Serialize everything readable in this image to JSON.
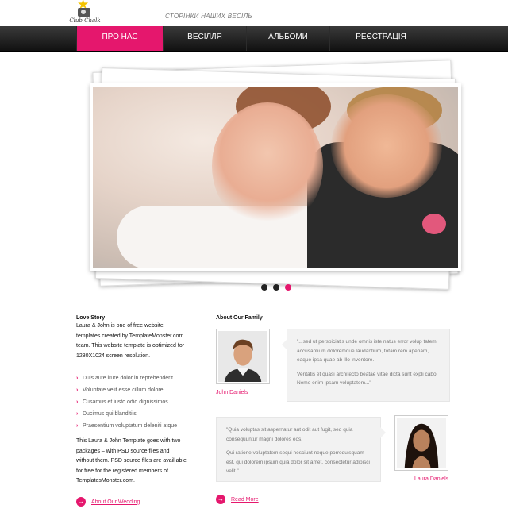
{
  "header": {
    "logo_text": "Club Chalk",
    "tagline": "СТОРІНКИ НАШИХ ВЕСІЛЬ"
  },
  "nav": {
    "items": [
      {
        "label": "ПРО НАС",
        "active": true
      },
      {
        "label": "ВЕСІЛЛЯ",
        "active": false
      },
      {
        "label": "АЛЬБОМИ",
        "active": false
      },
      {
        "label": "РЕЄСТРАЦІЯ",
        "active": false
      }
    ]
  },
  "slider": {
    "image": "wedding-couple-photo",
    "pagination": {
      "count": 3,
      "active_index": 2
    }
  },
  "love_story": {
    "title": "Love Story",
    "intro": "Laura & John is one of free website templates created by TemplateMonster.com team. This website template is optimized for 1280X1024 screen resolution.",
    "bullets": [
      "Duis aute irure dolor in reprehenderit",
      "Voluptate velit esse cillum dolore",
      "Cusamus et iusto odio dignissimos",
      "Ducimus qui blanditiis",
      "Praesentium voluptatum deleniti atque"
    ],
    "paragraph": "This Laura & John Template goes with two packages – with PSD source files and without them. PSD source files are avail able for free for the registered members of TemplatesMonster.com.",
    "link": "About Our Wedding"
  },
  "family": {
    "title": "About Our Family",
    "people": [
      {
        "name": "John Daniels",
        "quote1": "\"...sed ut perspiciatis unde omnis iste natus error volup tatem accusantium doloremque laudantium, totam rem aperiam, eaque ipsa quae ab illo inventore.",
        "quote2": "Veritatis et quasi architecto beatae vitae dicta sunt expli cabo. Nemo enim ipsam voluptatem...\""
      },
      {
        "name": "Laura Daniels",
        "quote1": "\"Quia voluptas sit aspernatur aut odit aut fugit, sed quia consequuntur magni dolores eos.",
        "quote2": "Qui ratione voluptatem sequi nesciunt neque porroquisquam est, qui dolorem ipsum quia dolor sit amet, consectetur adipisci velit.\""
      }
    ],
    "link": "Read More"
  },
  "colors": {
    "accent": "#e5176d",
    "nav_bg": "#1a1a1a"
  }
}
